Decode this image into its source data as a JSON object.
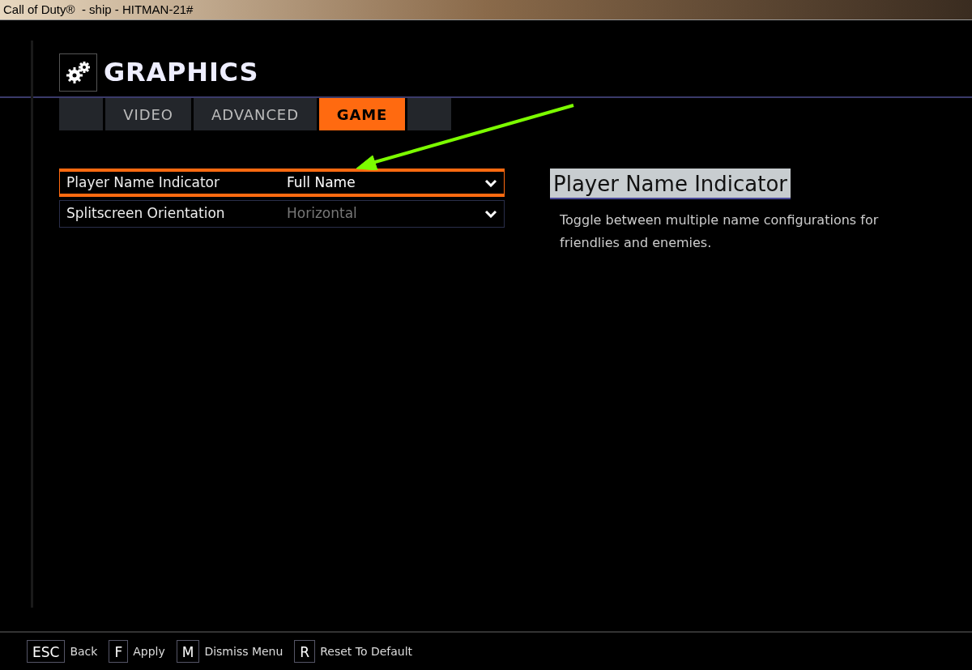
{
  "window": {
    "title": "Call of Duty®  - ship - HITMAN-21#"
  },
  "header": {
    "title": "GRAPHICS"
  },
  "tabs": [
    {
      "label": "VIDEO",
      "selected": false
    },
    {
      "label": "ADVANCED",
      "selected": false
    },
    {
      "label": "GAME",
      "selected": true
    }
  ],
  "settings": [
    {
      "label": "Player Name Indicator",
      "value": "Full Name",
      "selected": true,
      "disabled": false
    },
    {
      "label": "Splitscreen Orientation",
      "value": "Horizontal",
      "selected": false,
      "disabled": true
    }
  ],
  "details": {
    "title": "Player Name Indicator",
    "description": "Toggle between multiple name configurations for friendlies and enemies."
  },
  "footer": [
    {
      "key": "ESC",
      "action": "Back"
    },
    {
      "key": "F",
      "action": "Apply"
    },
    {
      "key": "M",
      "action": "Dismiss Menu"
    },
    {
      "key": "R",
      "action": "Reset To Default"
    }
  ]
}
